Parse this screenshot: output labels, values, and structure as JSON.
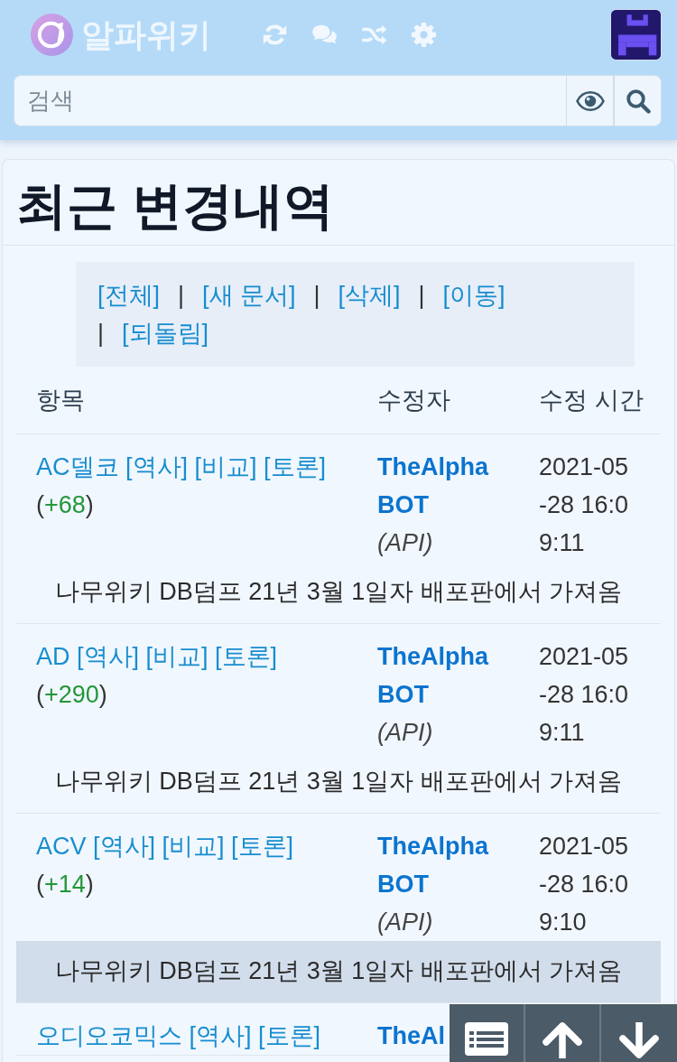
{
  "header": {
    "site_name": "알파위키",
    "search": {
      "placeholder": "검색"
    }
  },
  "page": {
    "title": "최근 변경내역"
  },
  "filters": [
    {
      "kind": "link",
      "text": "[전체]"
    },
    {
      "kind": "separator",
      "text": "|"
    },
    {
      "kind": "link",
      "text": "[새 문서]"
    },
    {
      "kind": "separator",
      "text": "|"
    },
    {
      "kind": "link",
      "text": "[삭제]"
    },
    {
      "kind": "separator",
      "text": "|"
    },
    {
      "kind": "link",
      "text": "[이동]"
    },
    {
      "kind": "separator",
      "text": "|"
    },
    {
      "kind": "link",
      "text": "[되돌림]"
    }
  ],
  "table": {
    "columns": [
      "항목",
      "수정자",
      "수정 시간"
    ],
    "rows": [
      {
        "title": "AC델코",
        "actions": [
          "[역사]",
          "[비교]",
          "[토론]"
        ],
        "delta": "(+68)",
        "author": "TheAlpha BOT",
        "via": "(API)",
        "time": "2021-05-28 16:09:11",
        "summary": {
          "text": "나무위키 DB덤프 21년 3월 1일자 배포판에서 가져옴",
          "highlighted": false
        }
      },
      {
        "title": "AD",
        "actions": [
          "[역사]",
          "[비교]",
          "[토론]"
        ],
        "delta": "(+290)",
        "author": "TheAlpha BOT",
        "via": "(API)",
        "time": "2021-05-28 16:09:11",
        "summary": {
          "text": "나무위키 DB덤프 21년 3월 1일자 배포판에서 가져옴",
          "highlighted": false
        }
      },
      {
        "title": "ACV",
        "actions": [
          "[역사]",
          "[비교]",
          "[토론]"
        ],
        "delta": "(+14)",
        "author": "TheAlpha BOT",
        "via": "(API)",
        "time": "2021-05-28 16:09:10",
        "summary": {
          "text": "나무위키 DB덤프 21년 3월 1일자 배포판에서 가져옴",
          "highlighted": true
        }
      },
      {
        "title": "오디오코믹스",
        "actions": [
          "[역사]",
          "[토론]"
        ],
        "author": "TheAl"
      }
    ]
  }
}
